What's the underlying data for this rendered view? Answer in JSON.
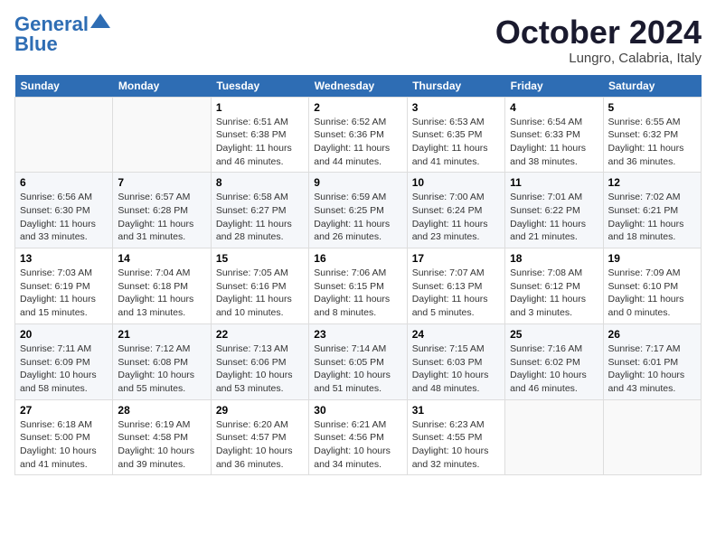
{
  "header": {
    "logo_line1": "General",
    "logo_line2": "Blue",
    "month": "October 2024",
    "location": "Lungro, Calabria, Italy"
  },
  "days_of_week": [
    "Sunday",
    "Monday",
    "Tuesday",
    "Wednesday",
    "Thursday",
    "Friday",
    "Saturday"
  ],
  "weeks": [
    [
      {
        "day": "",
        "info": ""
      },
      {
        "day": "",
        "info": ""
      },
      {
        "day": "1",
        "info": "Sunrise: 6:51 AM\nSunset: 6:38 PM\nDaylight: 11 hours and 46 minutes."
      },
      {
        "day": "2",
        "info": "Sunrise: 6:52 AM\nSunset: 6:36 PM\nDaylight: 11 hours and 44 minutes."
      },
      {
        "day": "3",
        "info": "Sunrise: 6:53 AM\nSunset: 6:35 PM\nDaylight: 11 hours and 41 minutes."
      },
      {
        "day": "4",
        "info": "Sunrise: 6:54 AM\nSunset: 6:33 PM\nDaylight: 11 hours and 38 minutes."
      },
      {
        "day": "5",
        "info": "Sunrise: 6:55 AM\nSunset: 6:32 PM\nDaylight: 11 hours and 36 minutes."
      }
    ],
    [
      {
        "day": "6",
        "info": "Sunrise: 6:56 AM\nSunset: 6:30 PM\nDaylight: 11 hours and 33 minutes."
      },
      {
        "day": "7",
        "info": "Sunrise: 6:57 AM\nSunset: 6:28 PM\nDaylight: 11 hours and 31 minutes."
      },
      {
        "day": "8",
        "info": "Sunrise: 6:58 AM\nSunset: 6:27 PM\nDaylight: 11 hours and 28 minutes."
      },
      {
        "day": "9",
        "info": "Sunrise: 6:59 AM\nSunset: 6:25 PM\nDaylight: 11 hours and 26 minutes."
      },
      {
        "day": "10",
        "info": "Sunrise: 7:00 AM\nSunset: 6:24 PM\nDaylight: 11 hours and 23 minutes."
      },
      {
        "day": "11",
        "info": "Sunrise: 7:01 AM\nSunset: 6:22 PM\nDaylight: 11 hours and 21 minutes."
      },
      {
        "day": "12",
        "info": "Sunrise: 7:02 AM\nSunset: 6:21 PM\nDaylight: 11 hours and 18 minutes."
      }
    ],
    [
      {
        "day": "13",
        "info": "Sunrise: 7:03 AM\nSunset: 6:19 PM\nDaylight: 11 hours and 15 minutes."
      },
      {
        "day": "14",
        "info": "Sunrise: 7:04 AM\nSunset: 6:18 PM\nDaylight: 11 hours and 13 minutes."
      },
      {
        "day": "15",
        "info": "Sunrise: 7:05 AM\nSunset: 6:16 PM\nDaylight: 11 hours and 10 minutes."
      },
      {
        "day": "16",
        "info": "Sunrise: 7:06 AM\nSunset: 6:15 PM\nDaylight: 11 hours and 8 minutes."
      },
      {
        "day": "17",
        "info": "Sunrise: 7:07 AM\nSunset: 6:13 PM\nDaylight: 11 hours and 5 minutes."
      },
      {
        "day": "18",
        "info": "Sunrise: 7:08 AM\nSunset: 6:12 PM\nDaylight: 11 hours and 3 minutes."
      },
      {
        "day": "19",
        "info": "Sunrise: 7:09 AM\nSunset: 6:10 PM\nDaylight: 11 hours and 0 minutes."
      }
    ],
    [
      {
        "day": "20",
        "info": "Sunrise: 7:11 AM\nSunset: 6:09 PM\nDaylight: 10 hours and 58 minutes."
      },
      {
        "day": "21",
        "info": "Sunrise: 7:12 AM\nSunset: 6:08 PM\nDaylight: 10 hours and 55 minutes."
      },
      {
        "day": "22",
        "info": "Sunrise: 7:13 AM\nSunset: 6:06 PM\nDaylight: 10 hours and 53 minutes."
      },
      {
        "day": "23",
        "info": "Sunrise: 7:14 AM\nSunset: 6:05 PM\nDaylight: 10 hours and 51 minutes."
      },
      {
        "day": "24",
        "info": "Sunrise: 7:15 AM\nSunset: 6:03 PM\nDaylight: 10 hours and 48 minutes."
      },
      {
        "day": "25",
        "info": "Sunrise: 7:16 AM\nSunset: 6:02 PM\nDaylight: 10 hours and 46 minutes."
      },
      {
        "day": "26",
        "info": "Sunrise: 7:17 AM\nSunset: 6:01 PM\nDaylight: 10 hours and 43 minutes."
      }
    ],
    [
      {
        "day": "27",
        "info": "Sunrise: 6:18 AM\nSunset: 5:00 PM\nDaylight: 10 hours and 41 minutes."
      },
      {
        "day": "28",
        "info": "Sunrise: 6:19 AM\nSunset: 4:58 PM\nDaylight: 10 hours and 39 minutes."
      },
      {
        "day": "29",
        "info": "Sunrise: 6:20 AM\nSunset: 4:57 PM\nDaylight: 10 hours and 36 minutes."
      },
      {
        "day": "30",
        "info": "Sunrise: 6:21 AM\nSunset: 4:56 PM\nDaylight: 10 hours and 34 minutes."
      },
      {
        "day": "31",
        "info": "Sunrise: 6:23 AM\nSunset: 4:55 PM\nDaylight: 10 hours and 32 minutes."
      },
      {
        "day": "",
        "info": ""
      },
      {
        "day": "",
        "info": ""
      }
    ]
  ]
}
